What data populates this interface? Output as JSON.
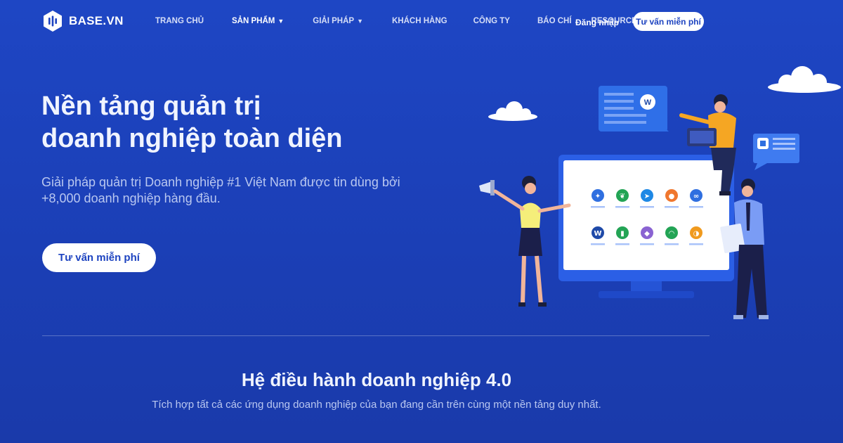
{
  "brand": {
    "name": "BASE.VN"
  },
  "nav": {
    "items": [
      {
        "label": "TRANG CHỦ",
        "caret": false,
        "active": false
      },
      {
        "label": "SẢN PHẨM",
        "caret": true,
        "active": true
      },
      {
        "label": "GIẢI PHÁP",
        "caret": true,
        "active": false
      },
      {
        "label": "KHÁCH HÀNG",
        "caret": false,
        "active": false
      },
      {
        "label": "CÔNG TY",
        "caret": false,
        "active": false
      },
      {
        "label": "BÁO CHÍ",
        "caret": false,
        "active": false
      },
      {
        "label": "RESOURCES",
        "caret": false,
        "active": false
      }
    ],
    "caret_glyph": "▼",
    "login_label": "Đăng nhập",
    "cta_label": "Tư vấn miễn phí"
  },
  "hero": {
    "title_line1": "Nền tảng quản trị",
    "title_line2": "doanh nghiệp toàn diện",
    "subtitle_line1": "Giải pháp quản trị Doanh nghiệp #1 Việt Nam được tin dùng bởi",
    "subtitle_line2": "+8,000 doanh nghiệp hàng đầu.",
    "cta_label": "Tư vấn miễn phí"
  },
  "section": {
    "title": "Hệ điều hành doanh nghiệp 4.0",
    "subtitle": "Tích hợp tất cả các ứng dụng doanh nghiệp của bạn đang cần trên cùng một nền tảng duy nhất."
  },
  "illustration": {
    "app_icons": [
      {
        "name": "base-account-icon",
        "color": "#2f6fe0",
        "glyph": "✦"
      },
      {
        "name": "base-workflow-icon",
        "color": "#23a455",
        "glyph": "❦"
      },
      {
        "name": "base-direct-icon",
        "color": "#1e88e5",
        "glyph": "➤"
      },
      {
        "name": "base-checkin-icon",
        "color": "#f0772e",
        "glyph": "●"
      },
      {
        "name": "base-meeting-icon",
        "color": "#2f6fe0",
        "glyph": "∞"
      },
      {
        "name": "base-wework-icon",
        "color": "#1f4aa8",
        "glyph": "W"
      },
      {
        "name": "base-request-icon",
        "color": "#23a455",
        "glyph": "▮"
      },
      {
        "name": "base-hiring-icon",
        "color": "#8a63d2",
        "glyph": "◆"
      },
      {
        "name": "base-goal-icon",
        "color": "#23a455",
        "glyph": "◠"
      },
      {
        "name": "base-inside-icon",
        "color": "#f09a1e",
        "glyph": "◑"
      }
    ],
    "chat_left_badge": "W",
    "colors": {
      "accent": "#1d43c0",
      "monitor": "#2b5fe6",
      "screen": "#ffffff"
    }
  }
}
